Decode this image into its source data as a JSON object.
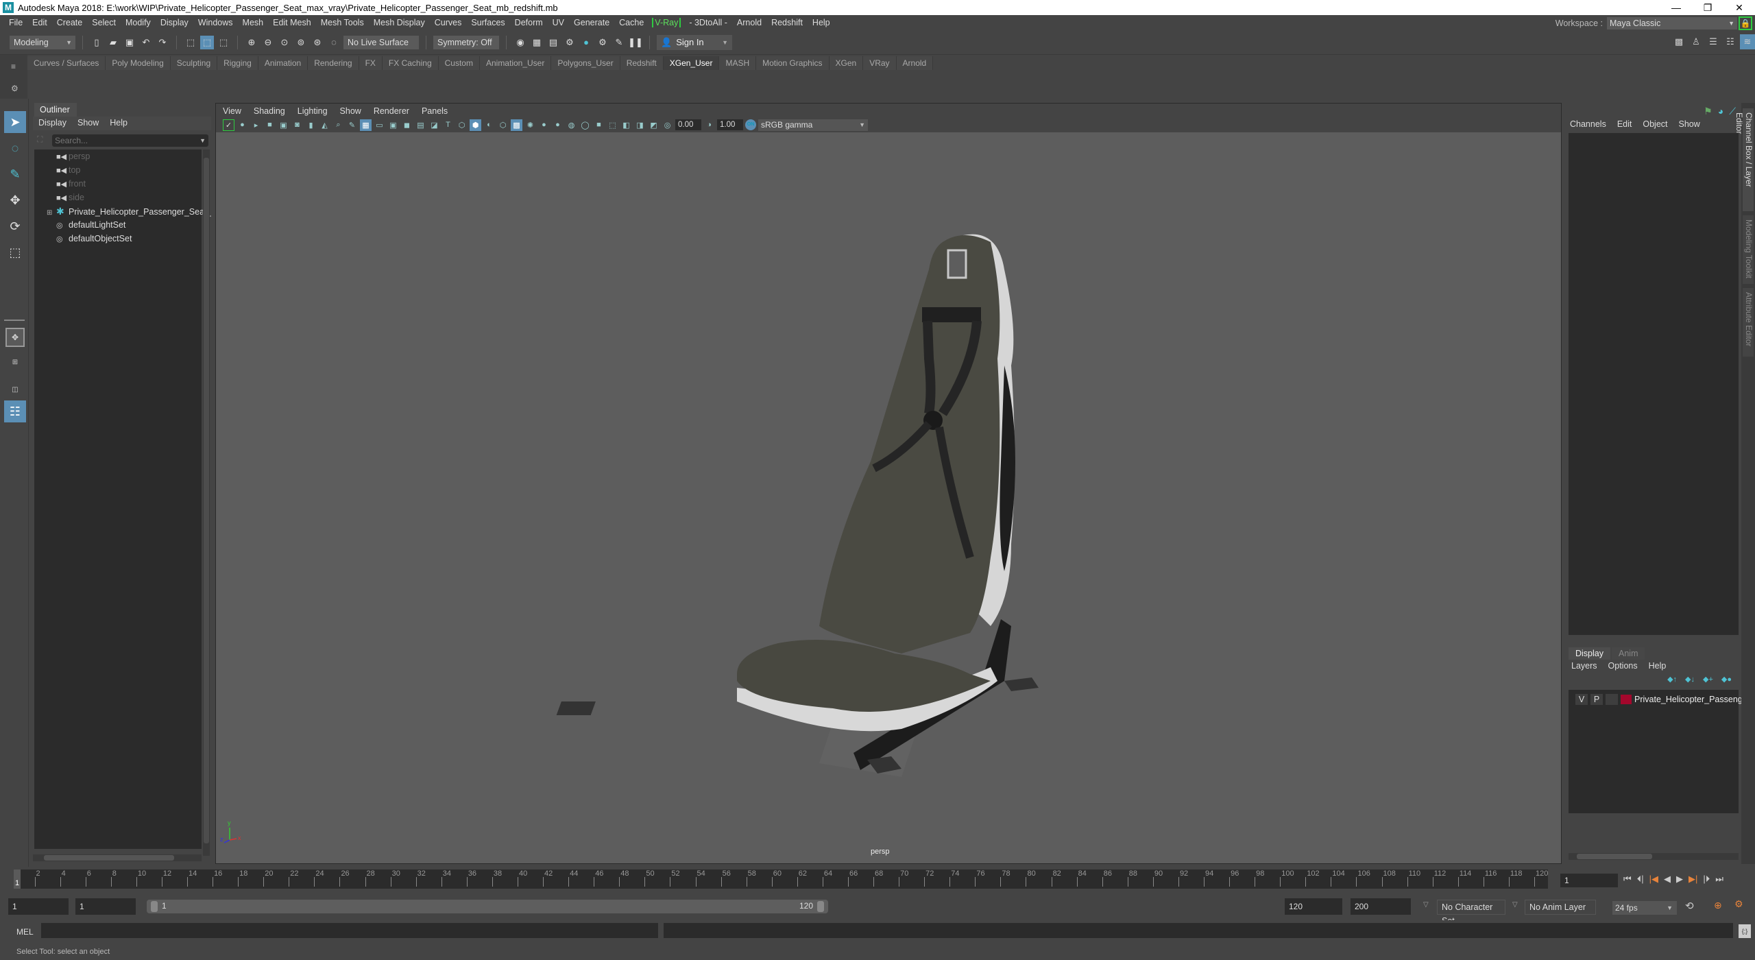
{
  "window": {
    "title": "Autodesk Maya 2018: E:\\work\\WIP\\Private_Helicopter_Passenger_Seat_max_vray\\Private_Helicopter_Passenger_Seat_mb_redshift.mb",
    "controls": {
      "minimize": "—",
      "restore": "❐",
      "close": "✕"
    }
  },
  "menubar": {
    "items": [
      "File",
      "Edit",
      "Create",
      "Select",
      "Modify",
      "Display",
      "Windows",
      "Mesh",
      "Edit Mesh",
      "Mesh Tools",
      "Mesh Display",
      "Curves",
      "Surfaces",
      "Deform",
      "UV",
      "Generate",
      "Cache"
    ],
    "vray": "V-Ray",
    "items2": [
      "- 3DtoAll -",
      "Arnold",
      "Redshift",
      "Help"
    ],
    "workspace_label": "Workspace :",
    "workspace_value": "Maya Classic"
  },
  "statusline": {
    "mode": "Modeling",
    "live_surface": "No Live Surface",
    "symmetry": "Symmetry: Off",
    "sign_in": "Sign In"
  },
  "shelf": {
    "tabs": [
      "Curves / Surfaces",
      "Poly Modeling",
      "Sculpting",
      "Rigging",
      "Animation",
      "Rendering",
      "FX",
      "FX Caching",
      "Custom",
      "Animation_User",
      "Polygons_User",
      "Redshift",
      "XGen_User",
      "MASH",
      "Motion Graphics",
      "XGen",
      "VRay",
      "Arnold"
    ],
    "active_tab": "XGen_User"
  },
  "outliner": {
    "title": "Outliner",
    "menu": [
      "Display",
      "Show",
      "Help"
    ],
    "search_placeholder": "Search...",
    "items": [
      {
        "label": "persp",
        "icon": "camera-icon",
        "dim": true
      },
      {
        "label": "top",
        "icon": "camera-icon",
        "dim": true
      },
      {
        "label": "front",
        "icon": "camera-icon",
        "dim": true
      },
      {
        "label": "side",
        "icon": "camera-icon",
        "dim": true
      },
      {
        "label": "Private_Helicopter_Passenger_Seat_n",
        "icon": "transform-icon",
        "dim": false,
        "expandable": true
      },
      {
        "label": "defaultLightSet",
        "icon": "set-icon",
        "dim": false
      },
      {
        "label": "defaultObjectSet",
        "icon": "set-icon",
        "dim": false
      }
    ]
  },
  "viewport": {
    "menu": [
      "View",
      "Shading",
      "Lighting",
      "Show",
      "Renderer",
      "Panels"
    ],
    "exposure": "0.00",
    "gamma": "1.00",
    "color_space": "sRGB gamma",
    "camera": "persp",
    "axis": {
      "x": "x",
      "y": "y",
      "z": "z"
    }
  },
  "channelbox": {
    "menu": [
      "Channels",
      "Edit",
      "Object",
      "Show"
    ]
  },
  "layer_editor": {
    "tabs": [
      "Display",
      "Anim"
    ],
    "menu": [
      "Layers",
      "Options",
      "Help"
    ],
    "layers": [
      {
        "v": "V",
        "p": "P",
        "name": "Private_Helicopter_Passenger_",
        "color": "#a3072c"
      }
    ]
  },
  "side_tabs": [
    "Channel Box / Layer Editor",
    "Modeling Toolkit",
    "Attribute Editor"
  ],
  "timeline": {
    "start": 1,
    "end": 120,
    "current_frame": "1",
    "tick_labels": [
      2,
      4,
      6,
      8,
      10,
      12,
      14,
      16,
      18,
      20,
      22,
      24,
      26,
      28,
      30,
      32,
      34,
      36,
      38,
      40,
      42,
      44,
      46,
      48,
      50,
      52,
      54,
      56,
      58,
      60,
      62,
      64,
      66,
      68,
      70,
      72,
      74,
      76,
      78,
      80,
      82,
      84,
      86,
      88,
      90,
      92,
      94,
      96,
      98,
      100,
      102,
      104,
      106,
      108,
      110,
      112,
      114,
      116,
      118,
      120
    ]
  },
  "range": {
    "start_field": "1",
    "playback_start": "1",
    "slider_start": "1",
    "slider_end": "120",
    "playback_end": "120",
    "end_field": "200",
    "character_set": "No Character Set",
    "anim_layer": "No Anim Layer",
    "fps": "24 fps"
  },
  "cmdline": {
    "label": "MEL"
  },
  "helpline": {
    "text": "Select Tool: select an object"
  }
}
